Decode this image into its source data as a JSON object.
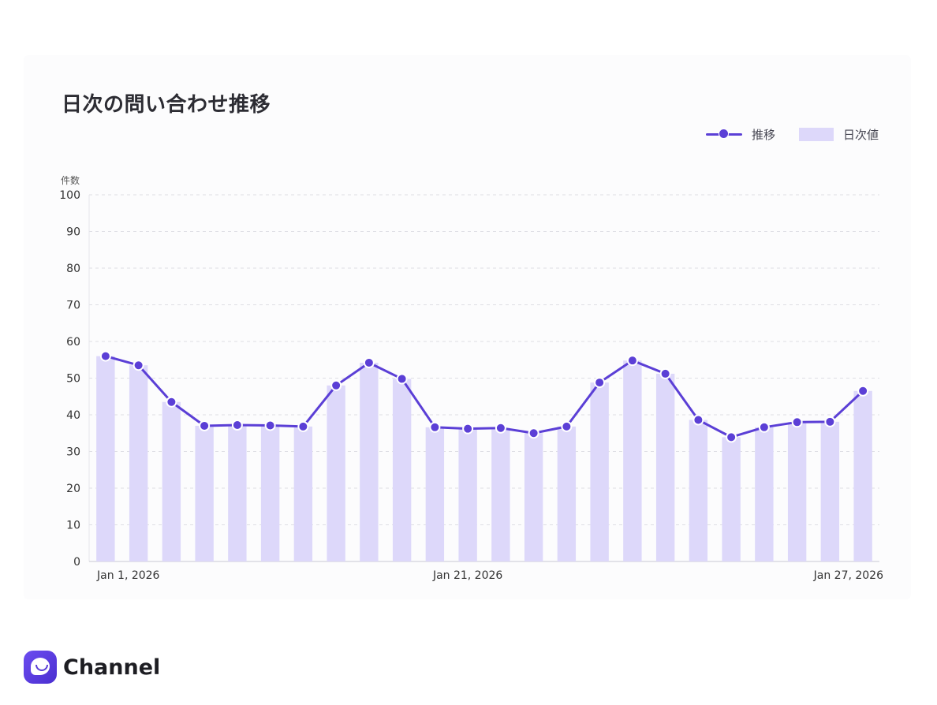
{
  "chart_data": {
    "type": "bar",
    "title": "日次の問い合わせ推移",
    "ylabel": "件数",
    "ylim": [
      0,
      100
    ],
    "yticks": [
      0,
      10,
      20,
      30,
      40,
      50,
      60,
      70,
      80,
      90,
      100
    ],
    "grid": true,
    "legend_position": "top-right",
    "x_tick_labels": [
      {
        "index": 0,
        "label": "Jan 1, 2026"
      },
      {
        "index": 11,
        "label": "Jan 21, 2026"
      },
      {
        "index": 23,
        "label": "Jan 27, 2026"
      }
    ],
    "series": [
      {
        "name": "推移",
        "type": "line",
        "color": "#5b3fd6",
        "values": [
          56,
          53.5,
          43.5,
          37,
          37.2,
          37.1,
          36.8,
          48,
          54.2,
          49.8,
          36.6,
          36.2,
          36.4,
          35,
          36.8,
          48.8,
          54.8,
          51.2,
          38.6,
          33.9,
          36.6,
          38,
          38.1,
          46.5
        ]
      },
      {
        "name": "日次値",
        "type": "bar",
        "color": "#ddd8fa",
        "values": [
          56,
          53.5,
          43.5,
          37,
          37.2,
          37.1,
          36.8,
          48,
          54.2,
          49.8,
          36.6,
          36.2,
          36.4,
          35,
          36.8,
          48.8,
          54.8,
          51.2,
          38.6,
          33.9,
          36.6,
          38,
          38.1,
          46.5
        ]
      }
    ]
  },
  "brand": {
    "name": "Channel"
  }
}
